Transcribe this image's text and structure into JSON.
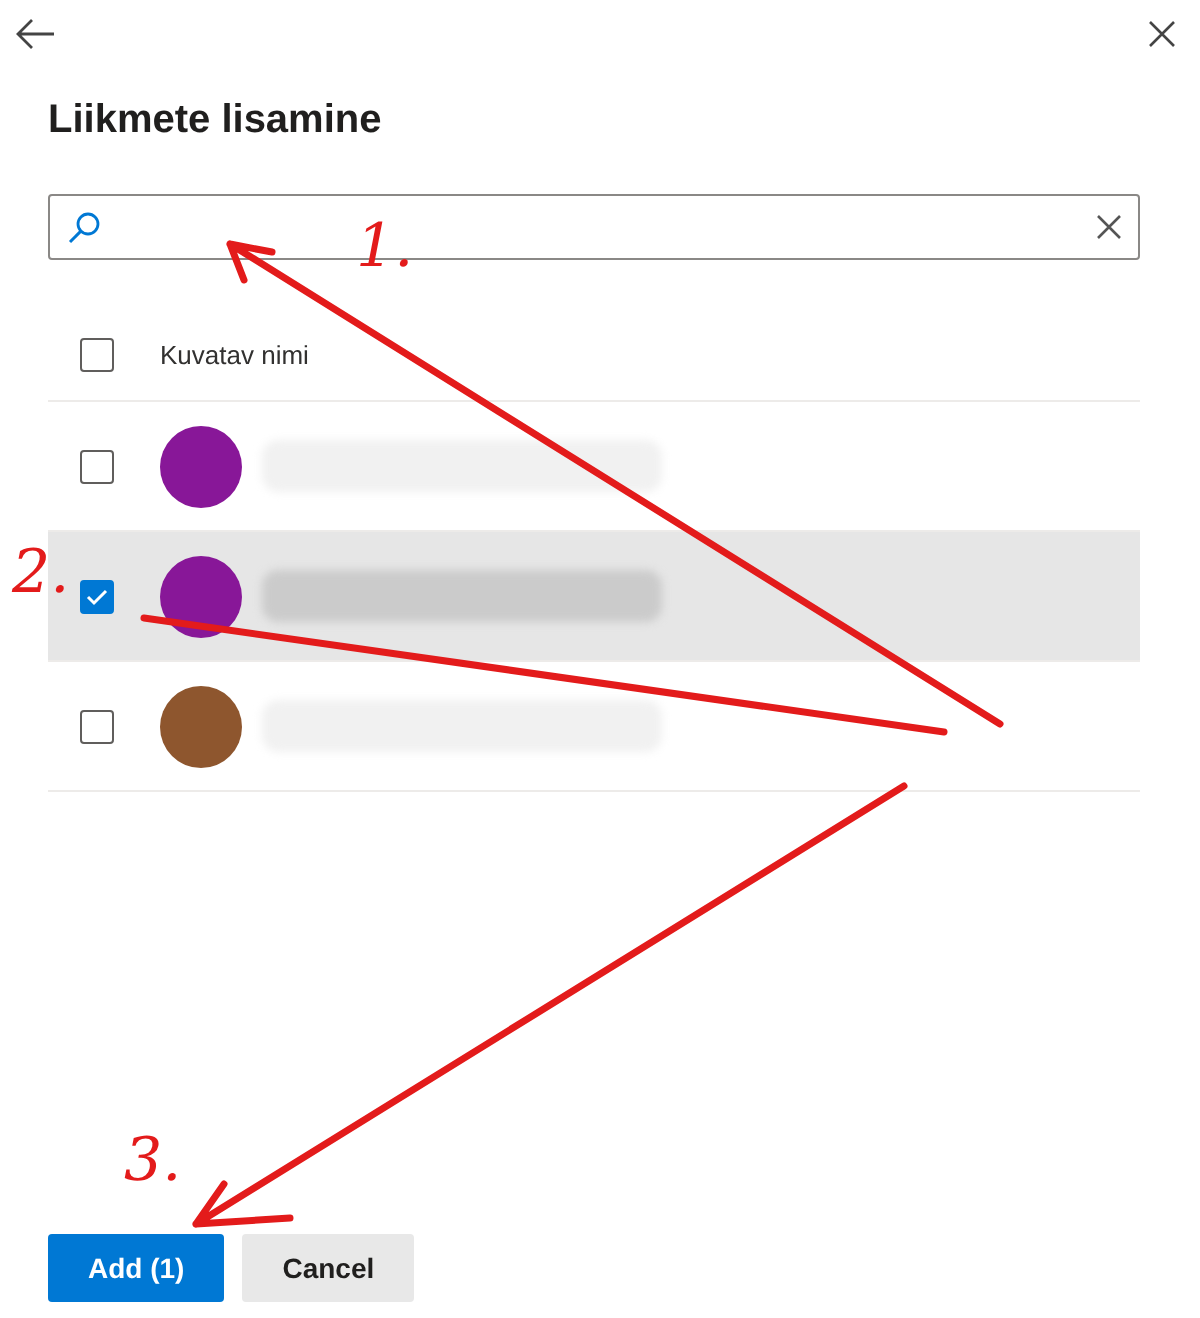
{
  "panel": {
    "title": "Liikmete lisamine"
  },
  "list": {
    "header": {
      "label": "Kuvatav nimi",
      "checked": false
    },
    "members": [
      {
        "color": "#881798",
        "selected": false,
        "checked": false,
        "name_redacted": true
      },
      {
        "color": "#881798",
        "selected": true,
        "checked": true,
        "name_redacted": true
      },
      {
        "color": "#8e562e",
        "selected": false,
        "checked": false,
        "name_redacted": true
      }
    ]
  },
  "buttons": [
    {
      "label": "Add (1)",
      "kind": "primary"
    },
    {
      "label": "Cancel",
      "kind": "secondary"
    }
  ],
  "annotations": [
    {
      "label": "1."
    },
    {
      "label": "2."
    },
    {
      "label": "3."
    }
  ]
}
